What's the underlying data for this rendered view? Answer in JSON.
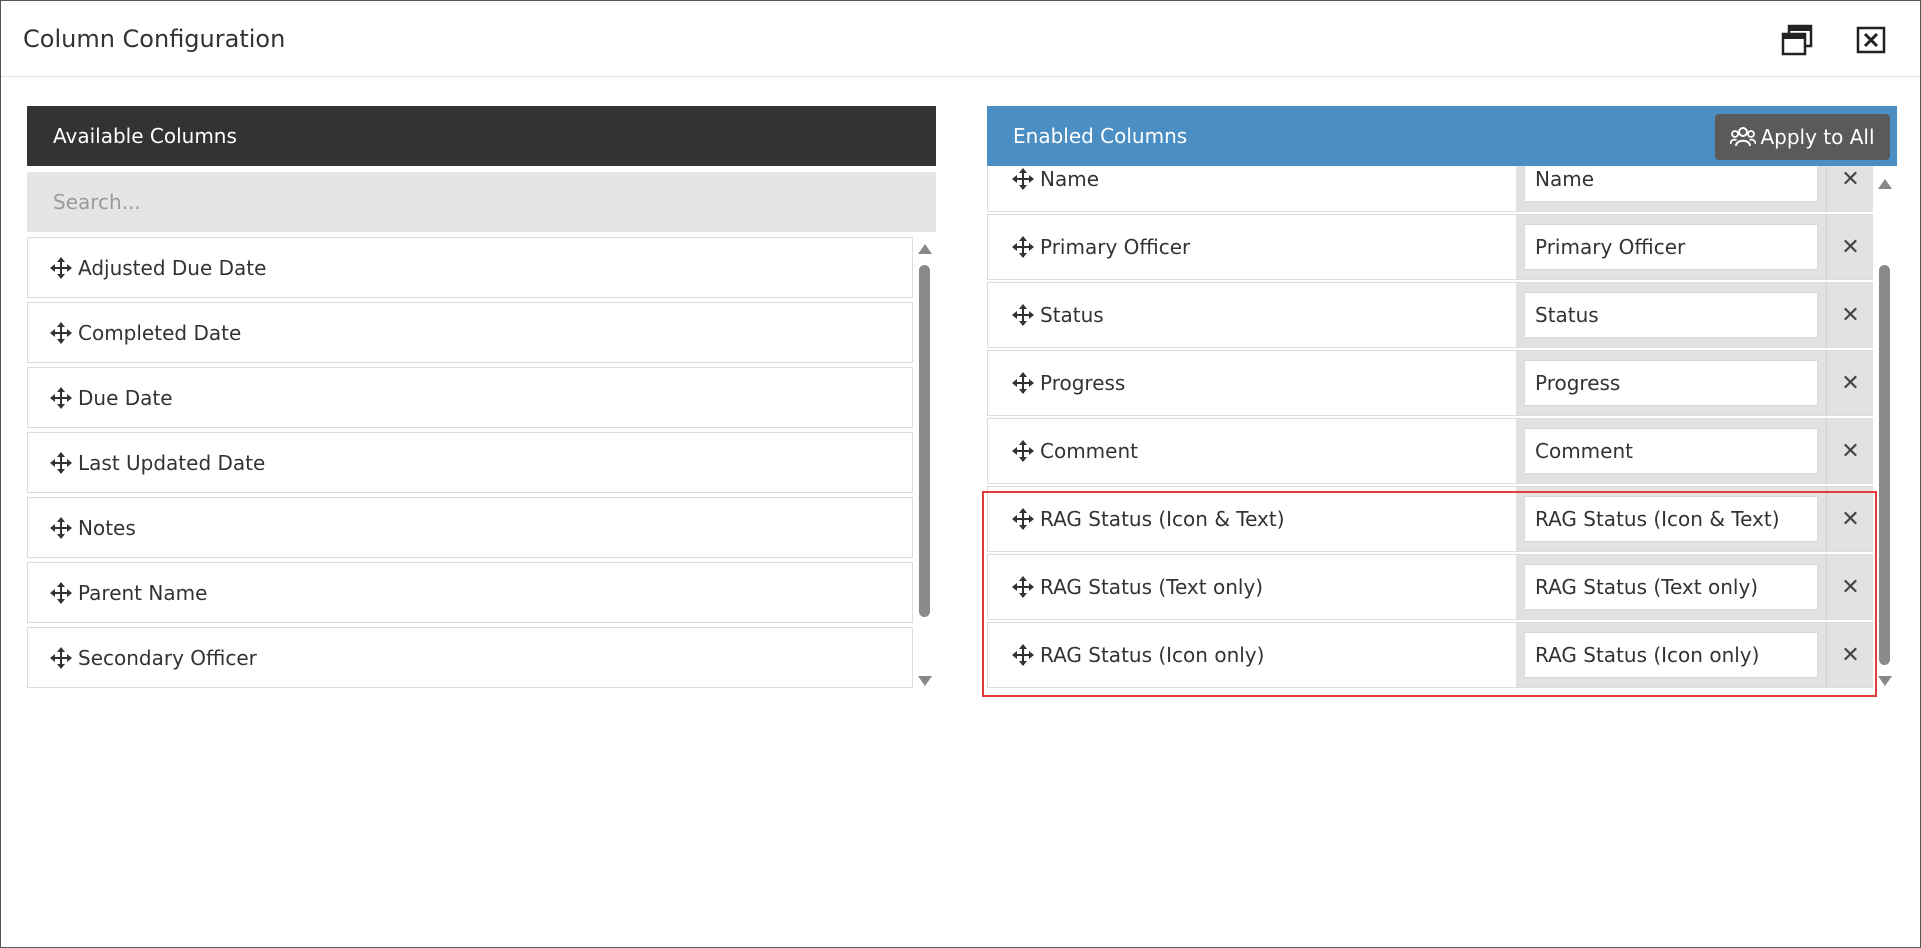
{
  "dialog": {
    "title": "Column Configuration",
    "restore_icon": "restore-window-icon",
    "close_icon": "close-box-icon"
  },
  "available": {
    "header": "Available Columns",
    "search_placeholder": "Search...",
    "items": [
      {
        "label": "Adjusted Due Date"
      },
      {
        "label": "Completed Date"
      },
      {
        "label": "Due Date"
      },
      {
        "label": "Last Updated Date"
      },
      {
        "label": "Notes"
      },
      {
        "label": "Parent Name"
      },
      {
        "label": "Secondary Officer"
      }
    ]
  },
  "enabled": {
    "header": "Enabled Columns",
    "apply_all_label": "Apply to All",
    "apply_all_icon": "users-group-icon",
    "rows": [
      {
        "name": "Name",
        "display": "Name"
      },
      {
        "name": "Primary Officer",
        "display": "Primary Officer"
      },
      {
        "name": "Status",
        "display": "Status"
      },
      {
        "name": "Progress",
        "display": "Progress"
      },
      {
        "name": "Comment",
        "display": "Comment"
      },
      {
        "name": "RAG Status (Icon & Text)",
        "display": "RAG Status (Icon & Text)"
      },
      {
        "name": "RAG Status (Text only)",
        "display": "RAG Status (Text only)"
      },
      {
        "name": "RAG Status (Icon only)",
        "display": "RAG Status (Icon only)"
      }
    ],
    "remove_symbol": "✕"
  },
  "colors": {
    "available_header_bg": "#333333",
    "enabled_header_bg": "#4a8ec4",
    "highlight_border": "#e03c3c"
  }
}
